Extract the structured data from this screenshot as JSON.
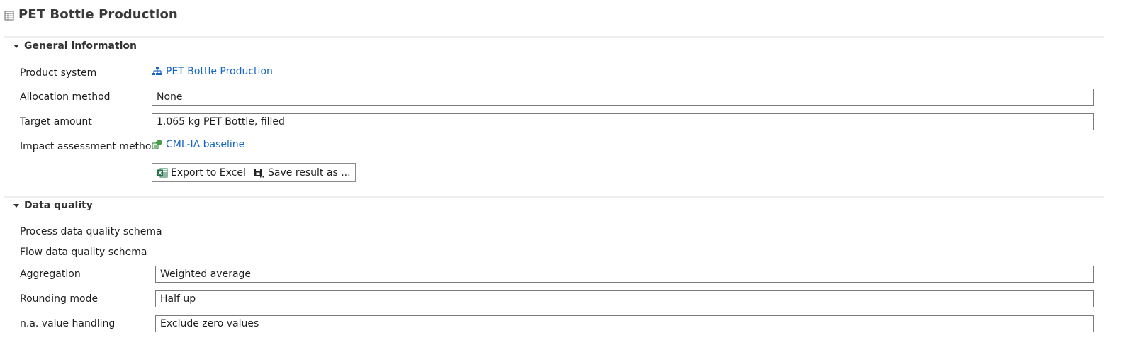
{
  "header": {
    "title": "PET Bottle Production",
    "icon": "table-icon"
  },
  "general": {
    "title": "General information",
    "product_system_label": "Product system",
    "product_system_value": "PET Bottle Production",
    "allocation_label": "Allocation method",
    "allocation_value": "None",
    "target_amount_label": "Target amount",
    "target_amount_value": "1.065 kg PET Bottle, filled",
    "impact_method_label": "Impact assessment method",
    "impact_method_value": "CML-IA baseline",
    "export_button": "Export to Excel",
    "save_button": "Save result as ..."
  },
  "data_quality": {
    "title": "Data quality",
    "process_schema_label": "Process data quality schema",
    "flow_schema_label": "Flow data quality schema",
    "aggregation_label": "Aggregation",
    "aggregation_value": "Weighted average",
    "rounding_label": "Rounding mode",
    "rounding_value": "Half up",
    "na_label": "n.a. value handling",
    "na_value": "Exclude zero values"
  },
  "colors": {
    "link": "#1565c0",
    "title": "#3a3a3a",
    "excel_green": "#1e7145"
  }
}
